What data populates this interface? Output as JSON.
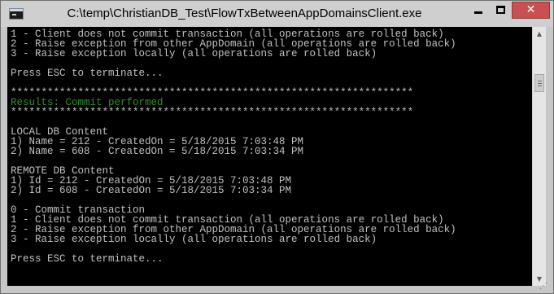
{
  "window": {
    "title": "C:\\temp\\ChristianDB_Test\\FlowTxBetweenAppDomainsClient.exe",
    "controls": {
      "minimize": "minimize-icon",
      "maximize": "maximize-icon",
      "close": "close-icon"
    }
  },
  "console": {
    "text_color": "#c0c0c0",
    "background": "#000000",
    "results_color": "#2f8f2f",
    "lines_before_results": [
      "1 - Client does not commit transaction (all operations are rolled back)",
      "2 - Raise exception from other AppDomain (all operations are rolled back)",
      "3 - Raise exception locally (all operations are rolled back)",
      "",
      "Press ESC to terminate...",
      "",
      "******************************************************************"
    ],
    "results_line": "Results: Commit performed",
    "lines_after_results": [
      "******************************************************************",
      "",
      "LOCAL DB Content",
      "1) Name = 212 - CreatedOn = 5/18/2015 7:03:48 PM",
      "2) Name = 608 - CreatedOn = 5/18/2015 7:03:34 PM",
      "",
      "REMOTE DB Content",
      "1) Id = 212 - CreatedOn = 5/18/2015 7:03:48 PM",
      "2) Id = 608 - CreatedOn = 5/18/2015 7:03:34 PM",
      "",
      "0 - Commit transaction",
      "1 - Client does not commit transaction (all operations are rolled back)",
      "2 - Raise exception from other AppDomain (all operations are rolled back)",
      "3 - Raise exception locally (all operations are rolled back)",
      "",
      "Press ESC to terminate..."
    ]
  },
  "scrollbar": {
    "up_icon": "scroll-up-arrow-icon",
    "down_icon": "scroll-down-arrow-icon"
  }
}
